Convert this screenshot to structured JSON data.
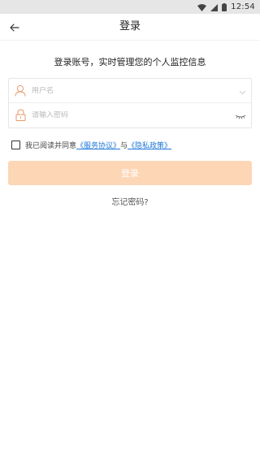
{
  "status_bar": {
    "time": "12:54",
    "icons": [
      "wifi-icon",
      "signal-icon",
      "battery-icon"
    ]
  },
  "nav": {
    "title": "登录",
    "back_icon": "arrow-left-icon"
  },
  "subtitle": "登录账号，实时管理您的个人监控信息",
  "form": {
    "username": {
      "value": "",
      "placeholder": "用户名",
      "icon": "user-icon",
      "right_icon": "chevron-down-icon"
    },
    "password": {
      "value": "",
      "placeholder": "请输入密码",
      "icon": "lock-icon",
      "right_icon": "eye-closed-icon"
    }
  },
  "agreement": {
    "checked": false,
    "prefix": "我已阅读并同意",
    "service_link": "《服务协议》",
    "joiner": "与",
    "privacy_link": "《隐私政策》"
  },
  "login_button": "登录",
  "forgot_password": "忘记密码?",
  "colors": {
    "accent": "#fdd6b6",
    "icon_orange": "#e89a6a",
    "link": "#1e78d6",
    "status_bar_bg": "#e6e6e6"
  }
}
